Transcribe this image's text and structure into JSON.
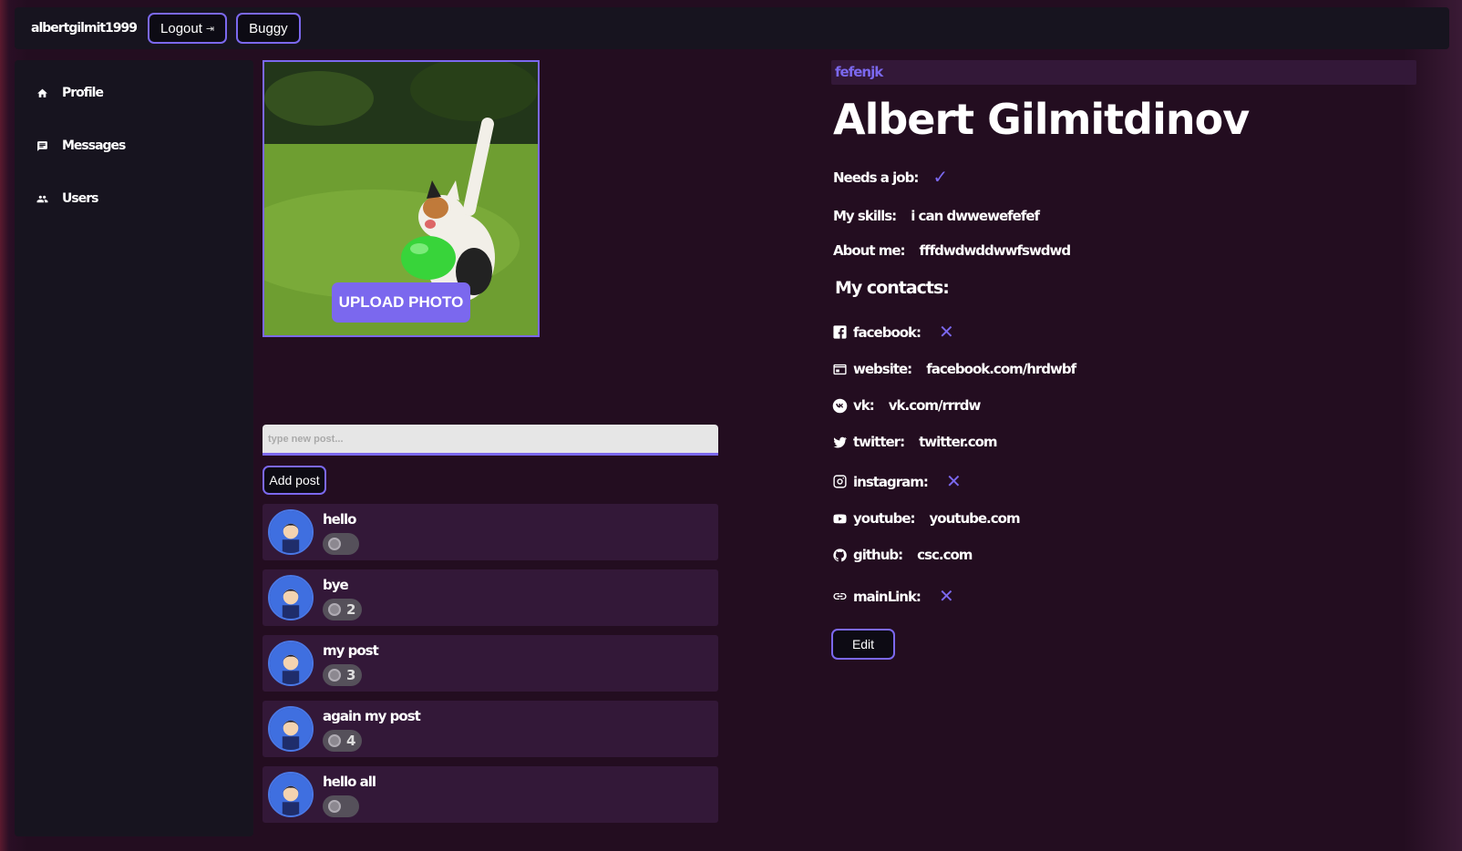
{
  "header": {
    "username": "albertgilmit1999",
    "logout_label": "Logout",
    "buggy_label": "Buggy"
  },
  "sidebar": {
    "items": [
      {
        "label": "Profile",
        "icon": "home-icon"
      },
      {
        "label": "Messages",
        "icon": "messages-icon"
      },
      {
        "label": "Users",
        "icon": "users-icon"
      }
    ]
  },
  "photo": {
    "upload_label": "UPLOAD PHOTO"
  },
  "new_post": {
    "placeholder": "type new post...",
    "add_label": "Add post"
  },
  "posts": [
    {
      "text": "hello",
      "likes": ""
    },
    {
      "text": "bye",
      "likes": "2"
    },
    {
      "text": "my post",
      "likes": "3"
    },
    {
      "text": "again my post",
      "likes": "4"
    },
    {
      "text": "hello all",
      "likes": ""
    }
  ],
  "profile": {
    "status": "fefenjk",
    "full_name": "Albert Gilmitdinov",
    "needs_job_label": "Needs a job:",
    "skills_label": "My skills:",
    "skills_value": "i can dwwewefefef",
    "about_label": "About me:",
    "about_value": "fffdwdwddwwfswdwd",
    "contacts_title": "My contacts:",
    "contacts": [
      {
        "label": "facebook:",
        "value": "",
        "icon": "facebook-icon"
      },
      {
        "label": "website:",
        "value": "facebook.com/hrdwbf",
        "icon": "website-icon"
      },
      {
        "label": "vk:",
        "value": "vk.com/rrrdw",
        "icon": "vk-icon"
      },
      {
        "label": "twitter:",
        "value": "twitter.com",
        "icon": "twitter-icon"
      },
      {
        "label": "instagram:",
        "value": "",
        "icon": "instagram-icon"
      },
      {
        "label": "youtube:",
        "value": "youtube.com",
        "icon": "youtube-icon"
      },
      {
        "label": "github:",
        "value": "csc.com",
        "icon": "github-icon"
      },
      {
        "label": "mainLink:",
        "value": "",
        "icon": "link-icon"
      }
    ],
    "edit_label": "Edit"
  },
  "colors": {
    "accent": "#7b68ee",
    "panel": "#17141f",
    "post_bg": "#331838"
  }
}
